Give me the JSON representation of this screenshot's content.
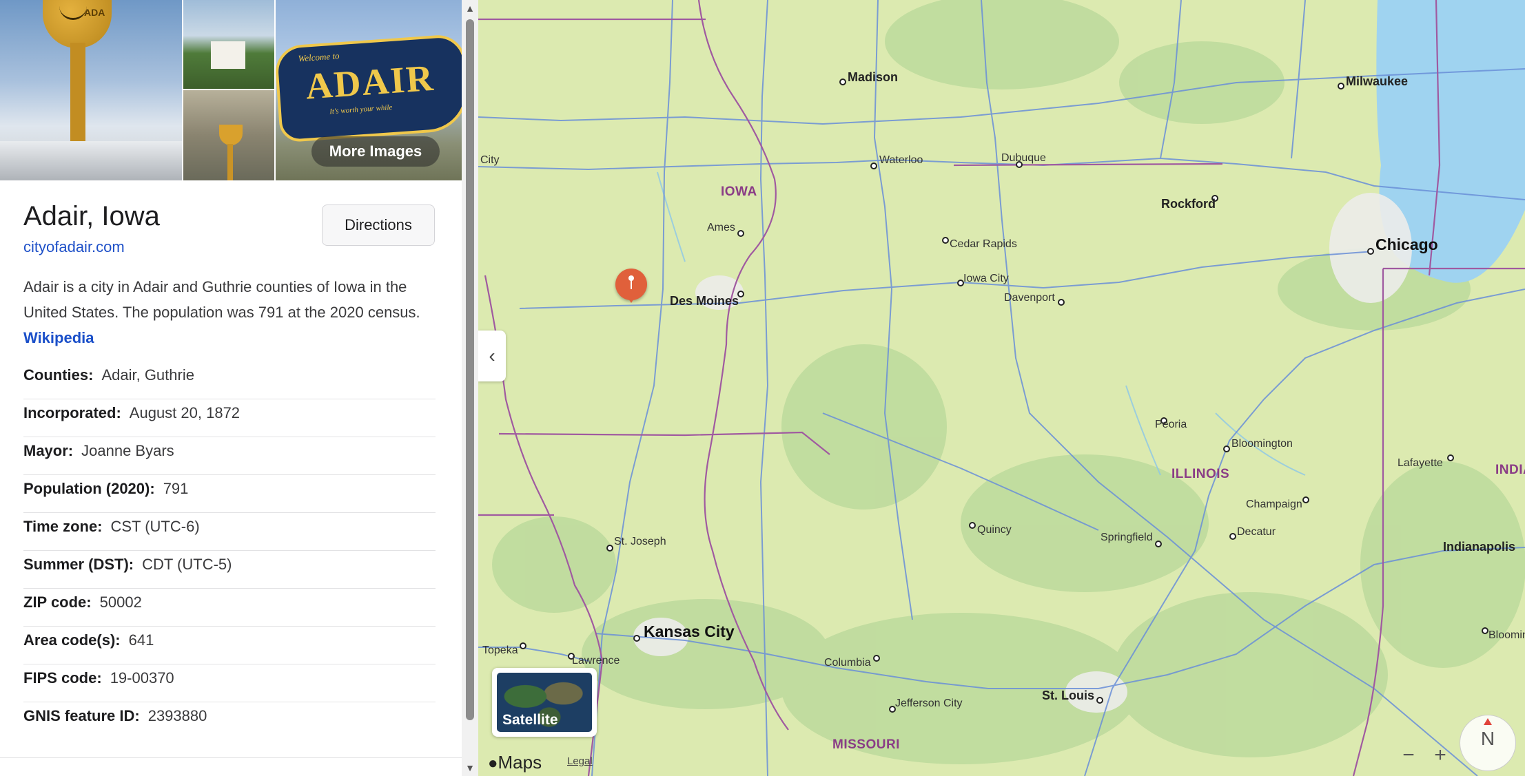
{
  "place": {
    "title": "Adair, Iowa",
    "website": "cityofadair.com",
    "description": "Adair is a city in Adair and Guthrie counties of Iowa in the United States. The population was 791 at the 2020 census.",
    "description_link": "Wikipedia",
    "directions_label": "Directions",
    "more_images_label": "More Images",
    "facts": [
      {
        "key": "Counties:",
        "value": "Adair, Guthrie"
      },
      {
        "key": "Incorporated:",
        "value": "August 20, 1872"
      },
      {
        "key": "Mayor:",
        "value": "Joanne Byars"
      },
      {
        "key": "Population (2020):",
        "value": "791"
      },
      {
        "key": "Time zone:",
        "value": "CST (UTC-6)"
      },
      {
        "key": "Summer (DST):",
        "value": "CDT (UTC-5)"
      },
      {
        "key": "ZIP code:",
        "value": "50002"
      },
      {
        "key": "Area code(s):",
        "value": "641"
      },
      {
        "key": "FIPS code:",
        "value": "19-00370"
      },
      {
        "key": "GNIS feature ID:",
        "value": "2393880"
      }
    ],
    "image_text": {
      "tower": "ADA",
      "sign_welcome": "Welcome to",
      "sign_word": "ADAIR",
      "sign_sub": "It's worth your while"
    }
  },
  "map": {
    "cities": {
      "madison": "Madison",
      "milwaukee": "Milwaukee",
      "city_edge": "City",
      "waterloo": "Waterloo",
      "dubuque": "Dubuque",
      "rockford": "Rockford",
      "chicago": "Chicago",
      "ames": "Ames",
      "cedar_rapids": "Cedar Rapids",
      "iowa_city": "Iowa City",
      "des_moines": "Des Moines",
      "davenport": "Davenport",
      "peoria": "Peoria",
      "bloomington": "Bloomington",
      "lafayette": "Lafayette",
      "champaign": "Champaign",
      "decatur": "Decatur",
      "springfield": "Springfield",
      "quincy": "Quincy",
      "st_joseph": "St. Joseph",
      "indianapolis": "Indianapolis",
      "bloomin_edge": "Bloomin",
      "kansas_city": "Kansas City",
      "topeka": "Topeka",
      "lawrence": "Lawrence",
      "columbia": "Columbia",
      "jefferson_city": "Jefferson City",
      "st_louis": "St. Louis"
    },
    "states": {
      "iowa": "IOWA",
      "illinois": "ILLINOIS",
      "indiana": "INDIA",
      "missouri": "MISSOURI"
    },
    "satellite_label": "Satellite",
    "maps_brand": "Maps",
    "legal_label": "Legal",
    "compass_label": "N",
    "zoom_out": "−",
    "zoom_in": "+",
    "collapse_icon": "‹",
    "colors": {
      "land": "#dceab0",
      "water": "#9fd3f0",
      "state_border": "#a05aa0",
      "road": "#6a8fd8",
      "pin": "#e0603b",
      "link": "#1e50c8"
    }
  },
  "scrollbar": {
    "up": "▲",
    "down": "▼"
  }
}
